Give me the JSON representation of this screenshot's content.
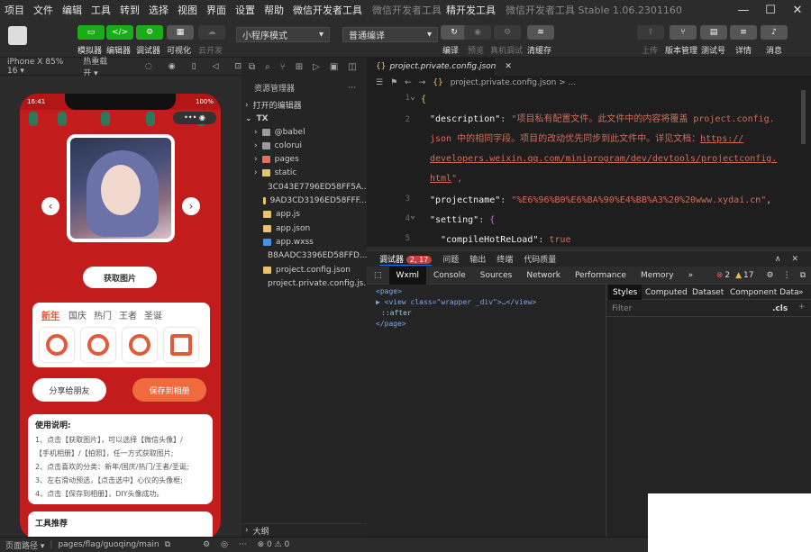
{
  "menu": [
    "项目",
    "文件",
    "编辑",
    "工具",
    "转到",
    "选择",
    "视图",
    "界面",
    "设置",
    "帮助",
    "微信开发者工具"
  ],
  "title_extra": [
    "微信开发者工具",
    "精开发工具"
  ],
  "app_title": "微信开发者工具 Stable 1.06.2301160",
  "toolbar": {
    "simulator": "模拟器",
    "editor": "编辑器",
    "debugger": "调试器",
    "visual": "可视化",
    "cloud": "云开发",
    "mode": "小程序模式",
    "compile_mode": "普通编译",
    "compile": "编译",
    "preview": "预览",
    "real_debug": "真机调试",
    "clear_cache": "清缓存",
    "upload": "上传",
    "version": "版本管理",
    "test": "测试号",
    "details": "详情",
    "messages": "消息"
  },
  "sim": {
    "device": "iPhone X 85% 16 ▾",
    "hot_reload": "热重载 开 ▾",
    "time": "16:41",
    "battery": "100%"
  },
  "phone": {
    "get_image": "获取图片",
    "categories": [
      "新年",
      "国庆",
      "热门",
      "王者",
      "圣诞"
    ],
    "share": "分享给朋友",
    "save": "保存到相册",
    "instr_title": "使用说明:",
    "instr_lines": [
      "1、点击【获取图片】，可以选择【微信头像】/",
      "【手机相册】/【拍照】，任一方式获取图片;",
      "2、点击喜欢的分类：新年/国庆/热门/王者/圣诞;",
      "3、左右滑动预选，【点击选中】心仪的头像框;",
      "4、点击【保存到相册】，DIY头像成功。"
    ],
    "tools_title": "工具推荐"
  },
  "explorer": {
    "title": "资源管理器",
    "open_editors": "打开的编辑器",
    "project": "TX",
    "items": [
      {
        "name": "@babel",
        "type": "folder"
      },
      {
        "name": "colorui",
        "type": "folder"
      },
      {
        "name": "pages",
        "type": "folder-red"
      },
      {
        "name": "static",
        "type": "folder-yellow"
      },
      {
        "name": "3C043E7796ED58FF5A...",
        "type": "js"
      },
      {
        "name": "9AD3CD3196ED58FFF...",
        "type": "js"
      },
      {
        "name": "app.js",
        "type": "js"
      },
      {
        "name": "app.json",
        "type": "json"
      },
      {
        "name": "app.wxss",
        "type": "css"
      },
      {
        "name": "B8AADC3396ED58FFD...",
        "type": "js"
      },
      {
        "name": "project.config.json",
        "type": "json"
      },
      {
        "name": "project.private.config.js...",
        "type": "json"
      }
    ],
    "outline": "大纲"
  },
  "editor": {
    "tab": "project.private.config.json",
    "breadcrumb": "project.private.config.json > ...",
    "line_numbers": [
      "1",
      "2",
      "",
      "",
      "",
      "3",
      "",
      "4",
      "5"
    ],
    "desc_key": "\"description\"",
    "desc_val_1": "\"项目私有配置文件。此文件中的内容将覆盖 project.config.",
    "desc_val_2": "json 中的相同字段。项目的改动优先同步到此文件中。详见文档：",
    "desc_url_1": "https://",
    "desc_url_2": "developers.weixin.qq.com/miniprogram/dev/devtools/projectconfig.",
    "desc_url_3": "html",
    "desc_end": "\",",
    "pn_key": "\"projectname\"",
    "pn_val": "\"%E6%96%B0%E6%BA%90%E4%BB%A3%20%20www.xydai.cn\"",
    "setting_key": "\"setting\"",
    "hot_key": "\"compileHotReLoad\"",
    "hot_val": "true"
  },
  "devtools": {
    "tabs": [
      "调试器",
      "问题",
      "输出",
      "终端",
      "代码质量"
    ],
    "badge": "2, 17",
    "panels": [
      "Wxml",
      "Console",
      "Sources",
      "Network",
      "Performance",
      "Memory"
    ],
    "errors": "2",
    "warnings": "17",
    "wxml_lines": [
      "<page>",
      "▶ <view class=\"wrapper _div\">…</view>",
      "  ::after",
      "</page>"
    ],
    "style_tabs": [
      "Styles",
      "Computed",
      "Dataset",
      "Component Data"
    ],
    "filter": "Filter",
    "cls": ".cls"
  },
  "status": {
    "path_label": "页面路径 ▾",
    "path": "pages/flag/guoqing/main",
    "errors": "⊗ 0 ⚠ 0"
  }
}
